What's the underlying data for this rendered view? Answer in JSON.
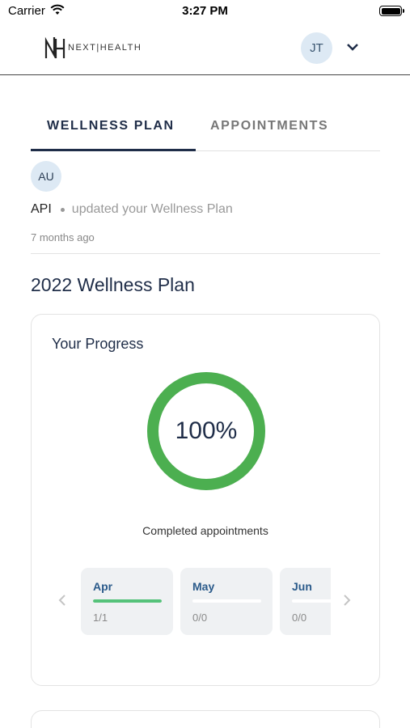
{
  "status_bar": {
    "carrier": "Carrier",
    "time": "3:27 PM"
  },
  "header": {
    "logo_text": "NEXT|HEALTH",
    "user_initials": "JT"
  },
  "tabs": [
    {
      "label": "WELLNESS PLAN",
      "active": true
    },
    {
      "label": "APPOINTMENTS",
      "active": false
    }
  ],
  "activity": {
    "avatar_initials": "AU",
    "actor": "API",
    "action": "updated your Wellness Plan",
    "time_ago": "7 months ago"
  },
  "plan": {
    "title": "2022 Wellness Plan",
    "progress": {
      "heading": "Your Progress",
      "percent_label": "100%",
      "percent_value": 1.0,
      "ring_color": "#4caf50",
      "caption": "Completed appointments",
      "months": [
        {
          "label": "Apr",
          "count": "1/1",
          "fraction": 1.0
        },
        {
          "label": "May",
          "count": "0/0",
          "fraction": 0.0
        },
        {
          "label": "Jun",
          "count": "0/0",
          "fraction": 0.0
        }
      ]
    }
  },
  "colors": {
    "accent": "#1f2d48",
    "progress_green": "#55c27a",
    "ring_green": "#4caf50",
    "avatar_bg": "#dde9f4"
  },
  "icons": [
    "wifi-icon",
    "battery-icon",
    "logo-mark-icon",
    "chevron-down-icon",
    "chevron-left-icon",
    "chevron-right-icon"
  ]
}
